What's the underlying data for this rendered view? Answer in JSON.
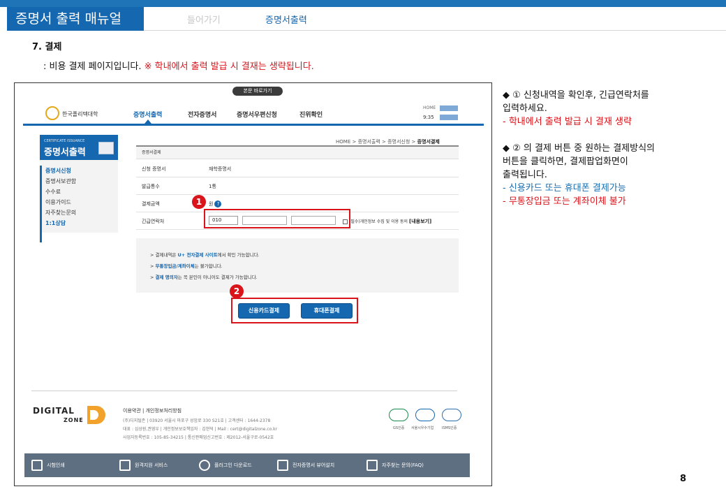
{
  "header": {
    "title": "증명서 출력 매뉴얼",
    "nav_prev": "들어가기",
    "nav_current": "증명서출력"
  },
  "step": {
    "title": "7. 결제",
    "desc_prefix": "  : 비용 결제 페이지입니다.  ",
    "desc_warning": "※ 학내에서 출력 발급 시 결재는 생략됩니다."
  },
  "shot": {
    "top_pill": "본문 바로가기",
    "site_logo": "한국폴리텍대학",
    "gnb": [
      "증명서출력",
      "전자증명서",
      "증명서우편신청",
      "진위확인"
    ],
    "home_label": "HOME",
    "clock": "9:35",
    "side_en": "CERTIFICATE ISSUANCE",
    "side_title": "증명서출력",
    "side_items": [
      "증명서신청",
      "증명서보관함",
      "수수료",
      "이용가이드",
      "자주찾는문의",
      "1:1상담"
    ],
    "breadcrumb": [
      "HOME",
      "증명서출력",
      "증명서신청",
      "증명서결제"
    ],
    "form_title": "증명서결제",
    "fields": {
      "cert_label": "신청 증명서",
      "cert_value": "재학증명서",
      "copies_label": "발급통수",
      "copies_value": "1통",
      "amount_label": "결제금액",
      "amount_value": "원",
      "contact_label": "긴급연락처",
      "contact_prefix": "010",
      "agree_text": "(필수)개인정보 수집 및 이용 동의",
      "agree_link": "[내용보기]"
    },
    "info_lines": [
      {
        "a": "> 결제내역은 ",
        "b": "U+ 전자결제 사이트",
        "c": "에서 확인 가능합니다."
      },
      {
        "a": "> ",
        "b": "무통장입금/계좌이체",
        "c": "는 불가합니다."
      },
      {
        "a": "> ",
        "b": "결제 명의자",
        "c": "는 꼭 본인이 아니어도 결제가 가능합니다."
      }
    ],
    "buttons": {
      "card": "신용카드결제",
      "phone": "휴대폰결제"
    },
    "badge1": "1",
    "badge2": "2",
    "footer": {
      "brand_a": "DIGITAL",
      "brand_b": "ZONE",
      "links": "이용약관 | 개인정보처리방침",
      "line1": "(주)디지털존 | 03920 서울시 마포구 성암로 330 S21호 | 고객센터 : 1644-2378",
      "line2": "대표 : 심상원,권영우 | 개인정보보호책임자 : 김현덕 | Mail : cert@digitalzone.co.kr",
      "line3": "사업자등록번호 : 105-85-34215 | 통신판매업신고번호 : 제2012-서울구로-0542호",
      "certs": [
        "GS인증",
        "서울시우수기업",
        "ISMS인증"
      ]
    },
    "bottom_bar": [
      "시험인쇄",
      "원격지원 서비스",
      "플러그인 다운로드",
      "전자증명서 뷰어설치",
      "자주찾는 문의(FAQ)"
    ]
  },
  "notes": {
    "n1_a": "◆ ① 신청내역을 확인후, 긴급연락처를",
    "n1_b": "   입력하세요.",
    "n1_c": "   - 학내에서 출력 발급 시 결재 생략",
    "n2_a": "◆ ② 의 결제 버튼 중 원하는 결제방식의",
    "n2_b": "   버튼을 클릭하면, 결제팝업화면이",
    "n2_c": "   출력됩니다.",
    "n2_d": "   - 신용카드 또는 휴대폰 결제가능",
    "n2_e": "   - 무통장입금 또는 계좌이체 불가"
  },
  "page_number": "8"
}
